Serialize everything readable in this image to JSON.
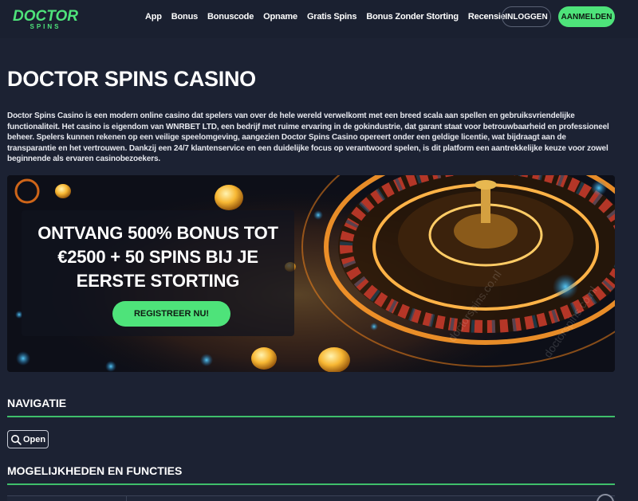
{
  "header": {
    "logo_text_main": "DOCTOR",
    "logo_text_sub": "SPINS",
    "nav": [
      "App",
      "Bonus",
      "Bonuscode",
      "Opname",
      "Gratis Spins",
      "Bonus Zonder Storting",
      "Recensie"
    ],
    "login_label": "INLOGGEN",
    "signup_label": "AANMELDEN"
  },
  "main": {
    "title": "DOCTOR SPINS CASINO",
    "intro": "Doctor Spins Casino is een modern online casino dat spelers van over de hele wereld verwelkomt met een breed scala aan spellen en gebruiksvriendelijke functionaliteit. Het casino is eigendom van WNRBET LTD, een bedrijf met ruime ervaring in de gokindustrie, dat garant staat voor betrouwbaarheid en professioneel beheer. Spelers kunnen rekenen op een veilige speelomgeving, aangezien Doctor Spins Casino opereert onder een geldige licentie, wat bijdraagt aan de transparantie en het vertrouwen. Dankzij een 24/7 klantenservice en een duidelijke focus op verantwoord spelen, is dit platform een aantrekkelijke keuze voor zowel beginnende als ervaren casinobezoekers."
  },
  "banner": {
    "line1": "ONTVANG 500% BONUS TOT",
    "line2": "€2500 + 50 SPINS BIJ JE",
    "line3": "EERSTE STORTING",
    "cta_label": "REGISTREER NU!",
    "watermark": "doctorspins.co.nl"
  },
  "sections": {
    "nav_heading": "NAVIGATIE",
    "open_label": "Open",
    "features_heading": "MOGELIJKHEDEN EN FUNCTIES"
  },
  "colors": {
    "accent": "#4ee37a",
    "background": "#1c2233",
    "line": "#3fbf6b"
  },
  "icons": {
    "open_button": "search-icon"
  }
}
